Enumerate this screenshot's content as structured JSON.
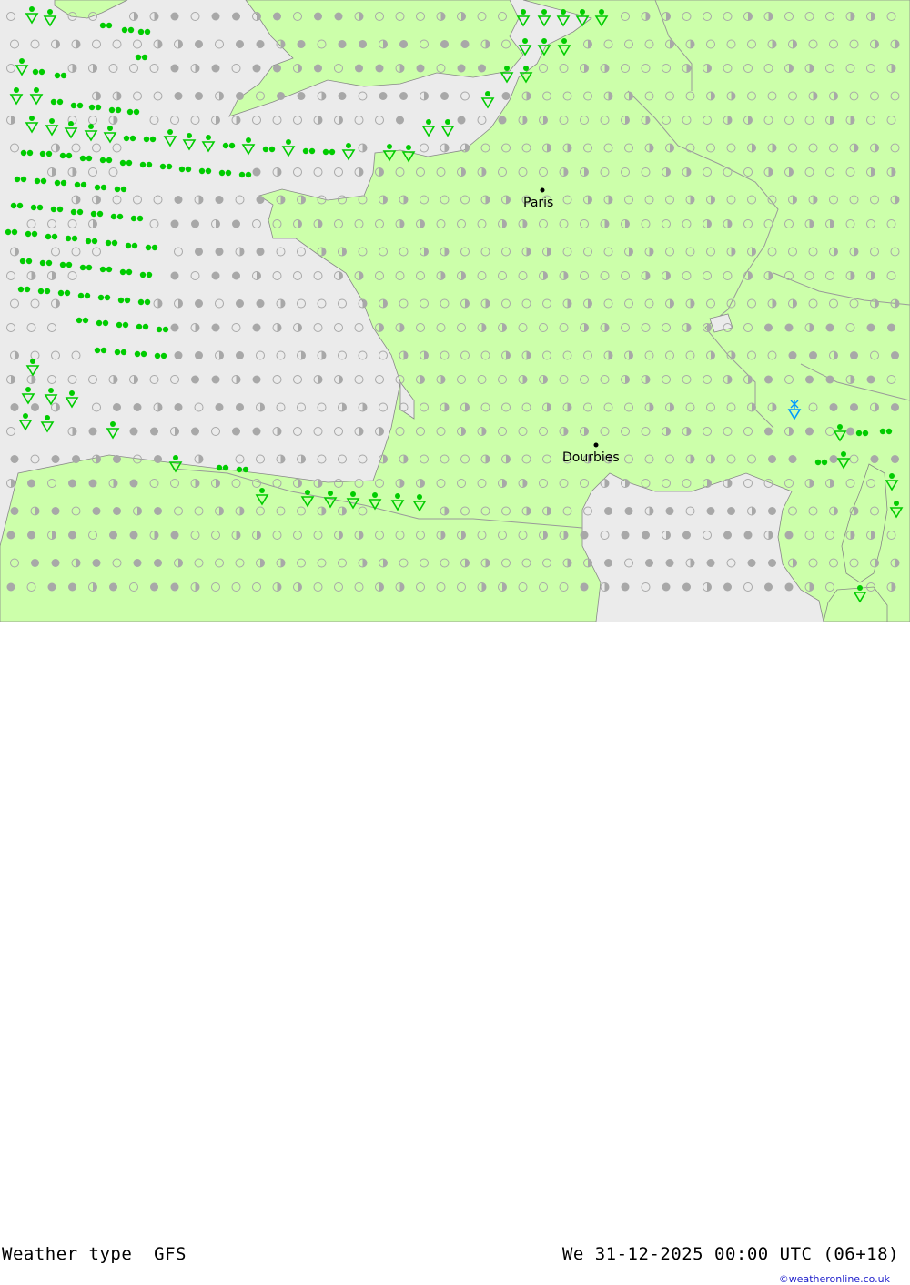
{
  "footer": {
    "title": "Weather type",
    "model": "GFS",
    "datetime": "We 31-12-2025 00:00 UTC (06+18)",
    "credit": "©weatheronline.co.uk"
  },
  "map": {
    "colors": {
      "sea": "#ebebeb",
      "land": "#ccffaa",
      "border": "#999999",
      "symbol_grey": "#a8a8a8",
      "rain_green": "#00cc00",
      "snow_blue": "#0099ff"
    },
    "cities": [
      {
        "name": "Paris",
        "icon": "city-dot-icon"
      },
      {
        "name": "Dourbies",
        "icon": "city-dot-icon"
      }
    ],
    "legend_symbols": [
      "clear-circle-icon",
      "half-cloud-circle-icon",
      "overcast-dot-icon",
      "drizzle-icon",
      "rain-shower-icon",
      "snow-shower-icon"
    ]
  }
}
